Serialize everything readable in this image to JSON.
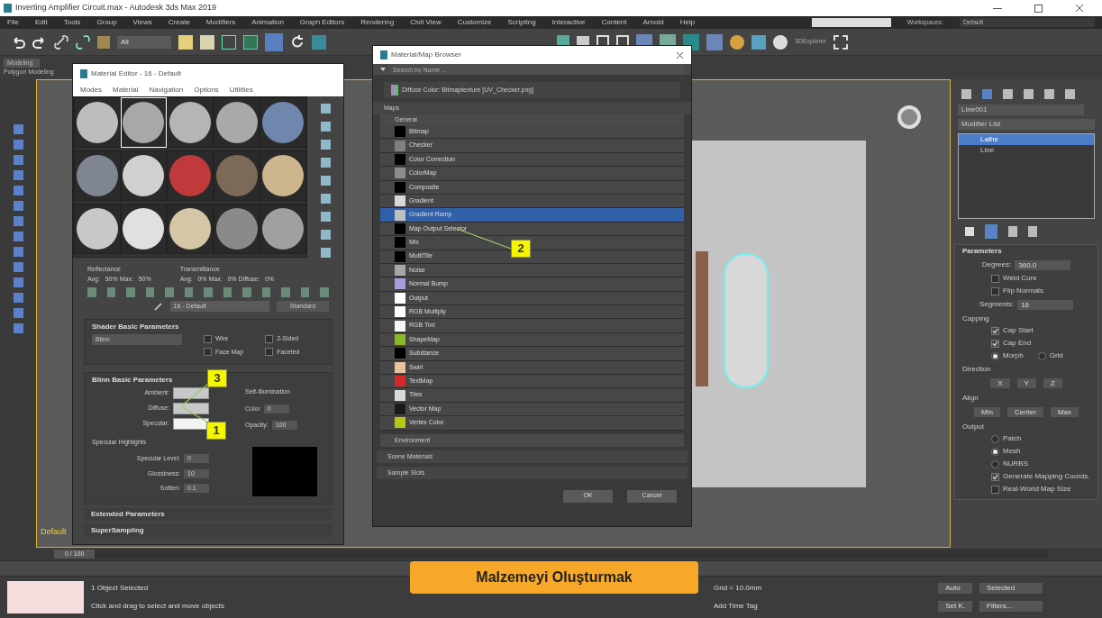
{
  "window": {
    "title": "Inverting Amplifier Circuit.max - Autodesk 3ds Max 2019"
  },
  "menu": [
    "File",
    "Edit",
    "Tools",
    "Group",
    "Views",
    "Create",
    "Modifiers",
    "Animation",
    "Graph Editors",
    "Rendering",
    "Civil View",
    "Customize",
    "Scripting",
    "Interactive",
    "Content",
    "Arnold",
    "Help"
  ],
  "workspaces": {
    "label": "Workspaces:",
    "value": "Default"
  },
  "toolbar": {
    "filter": "All",
    "explorer": "3DExplorer"
  },
  "ribbon": {
    "tab": "Modeling",
    "subtab": "Polygon Modeling"
  },
  "command_panel": {
    "object_name": "Line001",
    "modifier_list": "Modifier List",
    "stack": [
      {
        "label": "Lathe",
        "selected": true
      },
      {
        "label": "Line",
        "selected": false
      }
    ],
    "rollout": "Parameters",
    "rows": [
      {
        "kind": "spinner",
        "label": "Degrees:",
        "value": "360.0"
      },
      {
        "kind": "check",
        "label": "Weld Core",
        "checked": false
      },
      {
        "kind": "check",
        "label": "Flip Normals",
        "checked": false
      },
      {
        "kind": "spinner",
        "label": "Segments:",
        "value": "16"
      },
      {
        "kind": "heading",
        "label": "Capping"
      },
      {
        "kind": "check",
        "label": "Cap Start",
        "checked": true
      },
      {
        "kind": "check",
        "label": "Cap End",
        "checked": true
      },
      {
        "kind": "radios",
        "options": [
          {
            "label": "Morph",
            "selected": true
          },
          {
            "label": "Grid",
            "selected": false
          }
        ]
      },
      {
        "kind": "heading",
        "label": "Direction"
      },
      {
        "kind": "buttons",
        "options": [
          "X",
          "Y",
          "Z"
        ]
      },
      {
        "kind": "heading",
        "label": "Align"
      },
      {
        "kind": "buttons",
        "options": [
          "Min",
          "Center",
          "Max"
        ]
      },
      {
        "kind": "heading",
        "label": "Output"
      },
      {
        "kind": "radios",
        "options": [
          {
            "label": "Patch",
            "selected": false
          }
        ]
      },
      {
        "kind": "radios",
        "options": [
          {
            "label": "Mesh",
            "selected": true
          }
        ]
      },
      {
        "kind": "radios",
        "options": [
          {
            "label": "NURBS",
            "selected": false
          }
        ]
      },
      {
        "kind": "check",
        "label": "Generate Mapping Coords.",
        "checked": true
      },
      {
        "kind": "check",
        "label": "Real-World Map Size",
        "checked": false
      }
    ]
  },
  "material_editor": {
    "title": "Material Editor - 16 - Default",
    "menu": [
      "Modes",
      "Material",
      "Navigation",
      "Options",
      "Utilities"
    ],
    "slots": [
      {
        "color": "#bdbdbd",
        "selected": false
      },
      {
        "color": "#a8a8a8",
        "selected": true
      },
      {
        "color": "#b5b5b5",
        "selected": false
      },
      {
        "color": "#a9a9a9",
        "selected": false
      },
      {
        "color": "#6f86ad",
        "selected": false
      },
      {
        "color": "#7f8691",
        "selected": false
      },
      {
        "color": "#d0d0d0",
        "selected": false
      },
      {
        "color": "#c0393b",
        "selected": false
      },
      {
        "color": "#7b6a57",
        "selected": false
      },
      {
        "color": "#cdb68e",
        "selected": false
      },
      {
        "color": "#c8c8c8",
        "selected": false
      },
      {
        "color": "#e0e0e0",
        "selected": false
      },
      {
        "color": "#d4c6a6",
        "selected": false
      },
      {
        "color": "#8a8a8a",
        "selected": false
      },
      {
        "color": "#a0a0a0",
        "selected": false
      }
    ],
    "reflectance": {
      "label": "Reflectance",
      "values": "Avg:   50% Max:   50%"
    },
    "transmittance": {
      "label": "Transmittance",
      "values": "Avg:   0% Max:   0% Diffuse:   0%"
    },
    "material_name": "16 - Default",
    "material_type": "Standard",
    "shader_rollout": "Shader Basic Parameters",
    "shader": "Blinn",
    "shader_options": [
      {
        "label": "Wire",
        "checked": false
      },
      {
        "label": "2-Sided",
        "checked": false
      },
      {
        "label": "Face Map",
        "checked": false
      },
      {
        "label": "Faceted",
        "checked": false
      }
    ],
    "blinn_rollout": "Blinn Basic Parameters",
    "colors": [
      {
        "label": "Ambient:",
        "color": "#c8c8c8"
      },
      {
        "label": "Diffuse:",
        "color": "#c8c8c8"
      },
      {
        "label": "Specular:",
        "color": "#f2f2f2"
      }
    ],
    "self_illumination": {
      "label": "Self-Illumination",
      "color_label": "Color",
      "value": "0"
    },
    "opacity": {
      "label": "Opacity:",
      "value": "100"
    },
    "highlights": {
      "label": "Specular Highlights",
      "fields": [
        {
          "label": "Specular Level:",
          "value": "0"
        },
        {
          "label": "Glossiness:",
          "value": "10"
        },
        {
          "label": "Soften:",
          "value": "0.1"
        }
      ]
    },
    "rollouts": [
      "Extended Parameters",
      "SuperSampling"
    ]
  },
  "map_browser": {
    "title": "Material/Map Browser",
    "search": {
      "placeholder": "Search by Name ..."
    },
    "current": "Diffuse Color: Bitmaptexture [UV_Checker.png]",
    "section": "Maps",
    "group": "General",
    "maps": [
      {
        "label": "Bitmap",
        "color": "#000000",
        "selected": false
      },
      {
        "label": "Checker",
        "color": "#808080",
        "selected": false
      },
      {
        "label": "Color Correction",
        "color": "#000000",
        "selected": false
      },
      {
        "label": "ColorMap",
        "color": "#8c8c8c",
        "selected": false
      },
      {
        "label": "Composite",
        "color": "#000000",
        "selected": false
      },
      {
        "label": "Gradient",
        "color": "#d9d9d9",
        "selected": false
      },
      {
        "label": "Gradient Ramp",
        "color": "#bfbfbf",
        "selected": true
      },
      {
        "label": "Map Output Selector",
        "color": "#000000",
        "selected": false
      },
      {
        "label": "Mix",
        "color": "#000000",
        "selected": false
      },
      {
        "label": "MultiTile",
        "color": "#000000",
        "selected": false
      },
      {
        "label": "Noise",
        "color": "#a6a6a6",
        "selected": false
      },
      {
        "label": "Normal Bump",
        "color": "#a99be0",
        "selected": false
      },
      {
        "label": "Output",
        "color": "#ffffff",
        "selected": false
      },
      {
        "label": "RGB Multiply",
        "color": "#ffffff",
        "selected": false
      },
      {
        "label": "RGB Tint",
        "color": "#f4f8f4",
        "selected": false
      },
      {
        "label": "ShapeMap",
        "color": "#8ab82a",
        "selected": false
      },
      {
        "label": "Substance",
        "color": "#000000",
        "selected": false
      },
      {
        "label": "Swirl",
        "color": "#e8c29a",
        "selected": false
      },
      {
        "label": "TextMap",
        "color": "#d62828",
        "selected": false
      },
      {
        "label": "Tiles",
        "color": "#d9d9d9",
        "selected": false
      },
      {
        "label": "Vector Map",
        "color": "#1a1a1a",
        "selected": false
      },
      {
        "label": "Vertex Color",
        "color": "#b5c818",
        "selected": false
      }
    ],
    "groups": [
      "Environment"
    ],
    "sections": [
      "Scene Materials",
      "Sample Slots"
    ],
    "buttons": [
      "OK",
      "Cancel"
    ]
  },
  "callouts": [
    "1",
    "2",
    "3"
  ],
  "caption": "Malzemeyi Oluşturmak",
  "time_slider": {
    "value": "0 / 100",
    "level": 0
  },
  "status": {
    "selection": "1 Object Selected",
    "prompt": "Click and drag to select and move objects",
    "grid": "Grid = 10.0mm",
    "time_tag": "Add Time Tag",
    "key_mode": "Selected",
    "filters": "Filters...",
    "auto": "Auto",
    "set_key": "Set K."
  },
  "bottom_left": "Default"
}
